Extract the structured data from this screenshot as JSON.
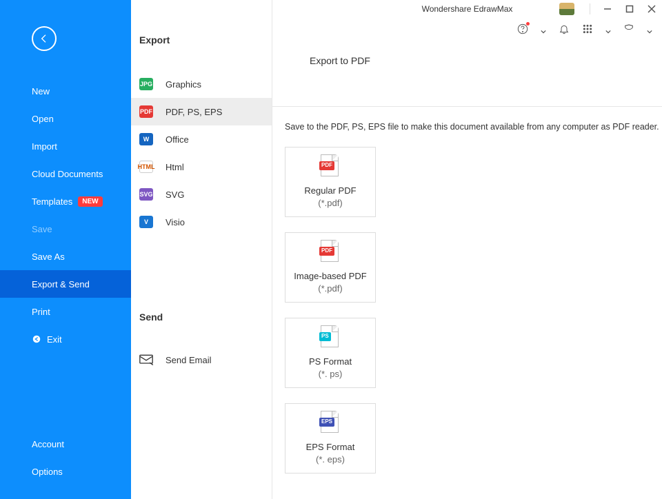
{
  "titlebar": {
    "app_title": "Wondershare EdrawMax"
  },
  "sidebar": {
    "items": [
      {
        "label": "New"
      },
      {
        "label": "Open"
      },
      {
        "label": "Import"
      },
      {
        "label": "Cloud Documents"
      },
      {
        "label": "Templates",
        "badge": "NEW"
      },
      {
        "label": "Save",
        "dim": true
      },
      {
        "label": "Save As"
      },
      {
        "label": "Export & Send",
        "active": true
      },
      {
        "label": "Print"
      },
      {
        "label": "Exit",
        "icon": "exit"
      }
    ],
    "bottom": [
      {
        "label": "Account"
      },
      {
        "label": "Options"
      }
    ]
  },
  "col2": {
    "export_title": "Export",
    "send_title": "Send",
    "export_items": [
      {
        "label": "Graphics",
        "icon": "jpg",
        "icon_text": "JPG"
      },
      {
        "label": "PDF, PS, EPS",
        "icon": "pdf",
        "icon_text": "PDF",
        "selected": true
      },
      {
        "label": "Office",
        "icon": "w",
        "icon_text": "W"
      },
      {
        "label": "Html",
        "icon": "htm",
        "icon_text": "HTML"
      },
      {
        "label": "SVG",
        "icon": "svg",
        "icon_text": "SVG"
      },
      {
        "label": "Visio",
        "icon": "v",
        "icon_text": "V"
      }
    ],
    "send_items": [
      {
        "label": "Send Email",
        "icon": "mail"
      }
    ]
  },
  "page": {
    "heading": "Export to PDF",
    "description": "Save to the PDF, PS, EPS file to make this document available from any computer as PDF reader.",
    "cards": [
      {
        "title": "Regular PDF",
        "sub": "(*.pdf)",
        "tag": "PDF",
        "tag_cls": "pdf"
      },
      {
        "title": "Image-based PDF",
        "sub": "(*.pdf)",
        "tag": "PDF",
        "tag_cls": "pdf"
      },
      {
        "title": "PS Format",
        "sub": "(*. ps)",
        "tag": "PS",
        "tag_cls": "ps"
      },
      {
        "title": "EPS Format",
        "sub": "(*. eps)",
        "tag": "EPS",
        "tag_cls": "eps"
      }
    ]
  }
}
